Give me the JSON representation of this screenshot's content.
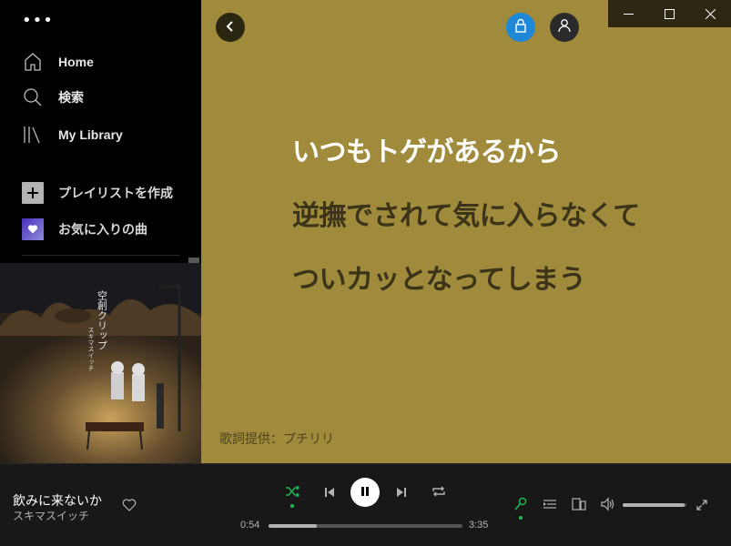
{
  "sidebar": {
    "menu_glyph": "•••",
    "nav": [
      {
        "label": "Home",
        "icon": "home-icon"
      },
      {
        "label": "検索",
        "icon": "search-icon"
      },
      {
        "label": "My Library",
        "icon": "library-icon"
      }
    ],
    "create_playlist": {
      "label": "プレイリストを作成",
      "icon": "plus-icon"
    },
    "liked_songs": {
      "label": "お気に入りの曲",
      "icon": "heart-icon"
    }
  },
  "album_art": {
    "title_text": "空創クリップ",
    "artist_text": "スキマスイッチ"
  },
  "lyrics": {
    "lines": [
      {
        "text": "いつもトゲがあるから",
        "active": true
      },
      {
        "text": "逆撫でされて気に入らなくて",
        "active": false
      },
      {
        "text": "ついカッとなってしまう",
        "active": false
      }
    ],
    "credit": "歌詞提供：プチリリ"
  },
  "player": {
    "track_title": "飲みに来ないか",
    "artist": "スキマスイッチ",
    "time_current": "0:54",
    "time_total": "3:35",
    "progress_fraction": 0.251,
    "volume_fraction": 0.97,
    "shuffle_active": true,
    "lyrics_active": true
  },
  "colors": {
    "lyrics_bg": "#a08a3c",
    "accent_green": "#1db954",
    "lock_blue": "#1e88d6"
  }
}
